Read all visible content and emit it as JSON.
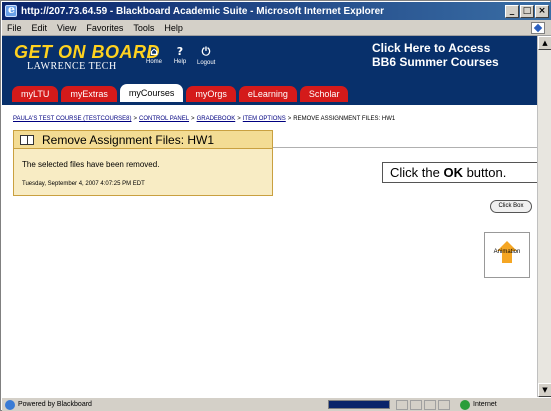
{
  "window": {
    "title": "http://207.73.64.59 - Blackboard Academic Suite - Microsoft Internet Explorer",
    "buttons": [
      "_",
      "□",
      "×"
    ]
  },
  "menu": [
    "File",
    "Edit",
    "View",
    "Favorites",
    "Tools",
    "Help"
  ],
  "header": {
    "logo_main": "GET ON BOARD",
    "logo_sub": "LAWRENCE TECH",
    "icons": [
      {
        "icon": "home-icon",
        "label": "Home"
      },
      {
        "icon": "help-icon",
        "label": "Help"
      },
      {
        "icon": "logout-icon",
        "label": "Logout"
      }
    ],
    "promo_line1": "Click Here to Access",
    "promo_line2": "BB6 Summer Courses"
  },
  "tabs": [
    {
      "label": "myLTU",
      "active": false
    },
    {
      "label": "myExtras",
      "active": false
    },
    {
      "label": "myCourses",
      "active": true
    },
    {
      "label": "myOrgs",
      "active": false
    },
    {
      "label": "eLearning",
      "active": false
    },
    {
      "label": "Scholar",
      "active": false
    }
  ],
  "breadcrumb": {
    "items": [
      "PAULA'S TEST COURSE (TESTCOURSE8)",
      "CONTROL PANEL",
      "GRADEBOOK",
      "ITEM OPTIONS"
    ],
    "current": "REMOVE ASSIGNMENT FILES: HW1",
    "separator": ">"
  },
  "receipt": {
    "title": "Remove Assignment Files: HW1",
    "message": "The selected files have been removed.",
    "timestamp": "Tuesday, September 4, 2007 4:07:25 PM EDT"
  },
  "callout": {
    "prefix": "Click the ",
    "bold": "OK",
    "suffix": " button."
  },
  "ok_button": {
    "label": "Click Box"
  },
  "animation": {
    "label": "Animation"
  },
  "statusbar": {
    "left_text": "Powered by Blackboard",
    "zone": "Internet"
  },
  "colors": {
    "banner": "#08306b",
    "tab": "#d41a1a",
    "logo": "#ffd21f",
    "receipt_bg": "#f8ecc4",
    "receipt_head": "#f3dc94"
  }
}
